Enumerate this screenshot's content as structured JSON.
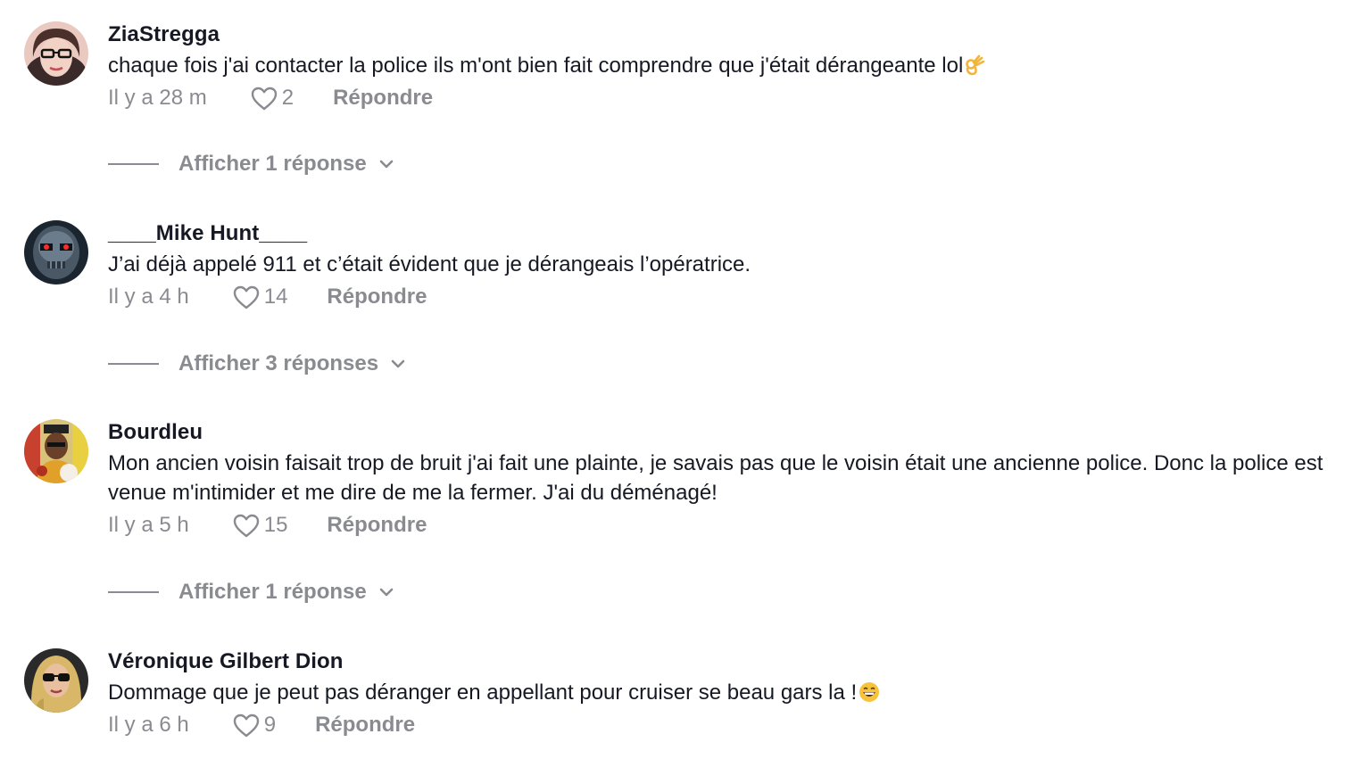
{
  "comments": [
    {
      "username": "ZiaStregga",
      "text": "chaque fois j'ai contacter la police ils m'ont bien fait comprendre que j'était dérangeante lol",
      "emoji": "ok-hand-emoji",
      "time": "Il y a 28 m",
      "likes": "2",
      "reply_label": "Répondre",
      "view_replies": "Afficher 1 réponse"
    },
    {
      "username": "____Mike Hunt____",
      "text": "J’ai déjà appelé 911 et c’était évident que je dérangeais l’opératrice.",
      "time": "Il y a 4 h",
      "likes": "14",
      "reply_label": "Répondre",
      "view_replies": "Afficher 3 réponses"
    },
    {
      "username": "Bourdleu",
      "text": "Mon ancien voisin faisait trop de bruit j'ai fait une plainte, je savais pas que le voisin était une ancienne police. Donc la police est venue m'intimider et me dire de me la fermer. J'ai du déménagé!",
      "time": "Il y a 5 h",
      "likes": "15",
      "reply_label": "Répondre",
      "view_replies": "Afficher 1 réponse"
    },
    {
      "username": "Véronique Gilbert Dion",
      "text": "Dommage que je peut pas déranger en appellant pour cruiser se beau gars la !",
      "emoji": "grinning-face-emoji",
      "time": "Il y a 6 h",
      "likes": "9",
      "reply_label": "Répondre"
    }
  ],
  "colors": {
    "primary_text": "#161823",
    "secondary_text": "#8a8b91",
    "background": "#ffffff"
  }
}
